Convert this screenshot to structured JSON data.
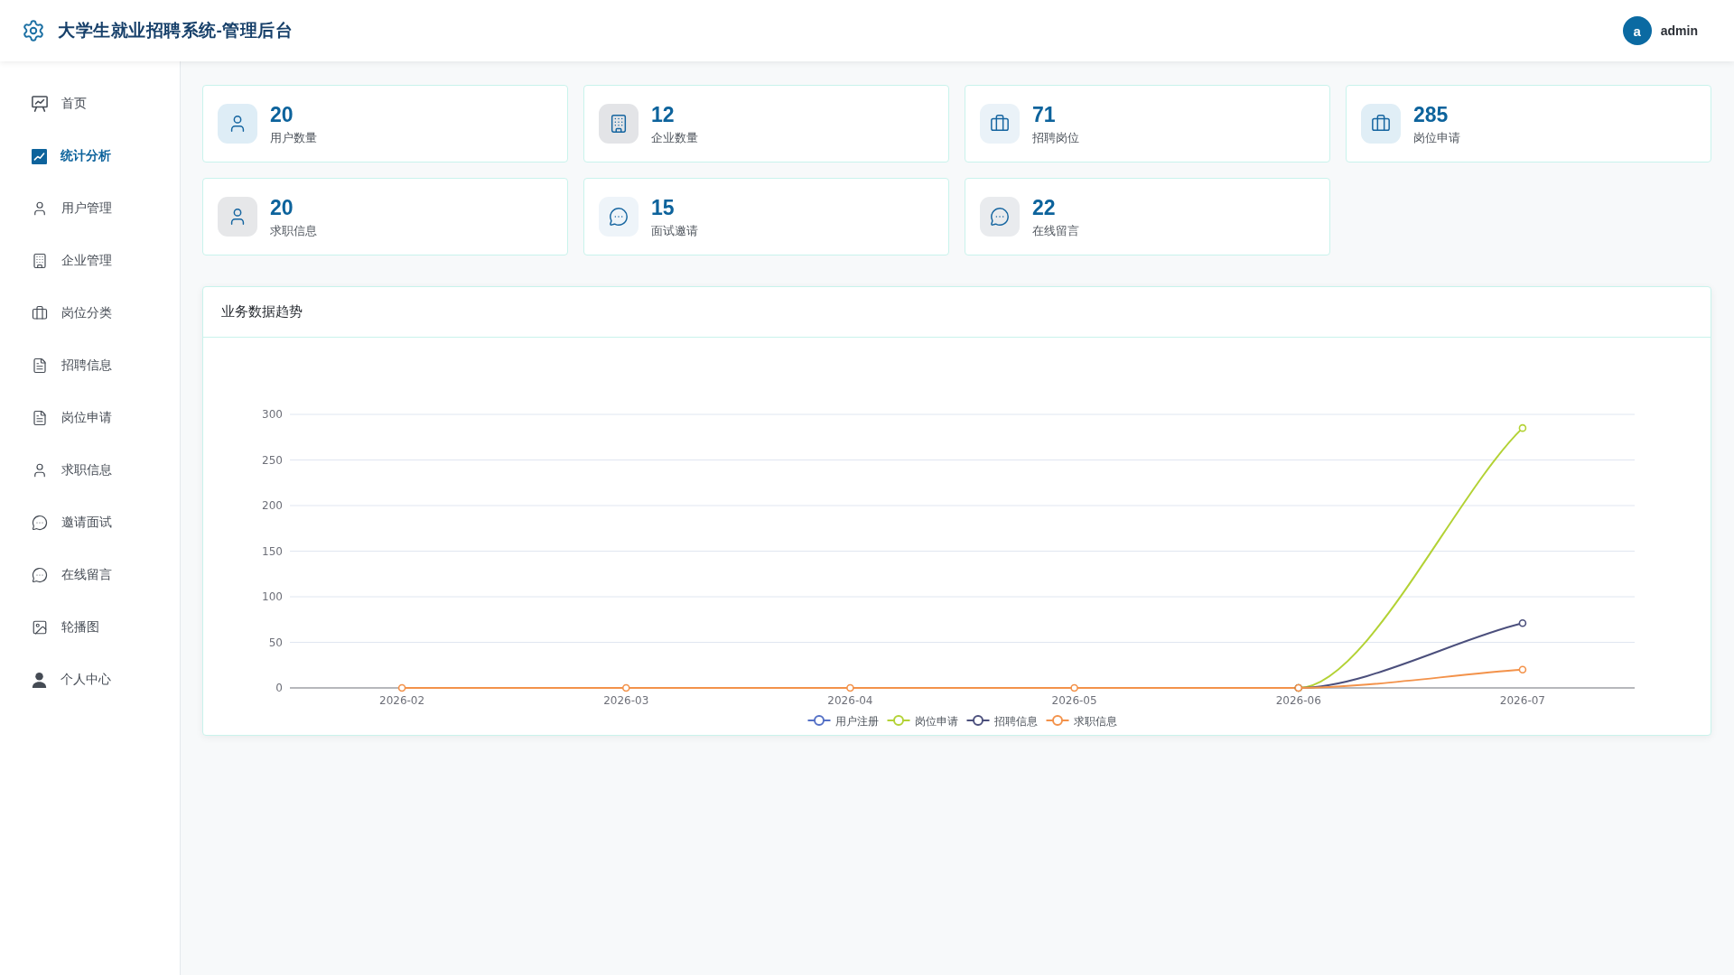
{
  "header": {
    "title": "大学生就业招聘系统-管理后台",
    "user": {
      "avatar_letter": "a",
      "name": "admin"
    }
  },
  "sidebar": {
    "items": [
      {
        "label": "首页",
        "kind": "home",
        "selected": false
      },
      {
        "label": "统计分析",
        "kind": "stats",
        "selected": true
      },
      {
        "label": "用户管理",
        "kind": "users",
        "selected": false
      },
      {
        "label": "企业管理",
        "kind": "companies",
        "selected": false
      },
      {
        "label": "岗位分类",
        "kind": "categories",
        "selected": false
      },
      {
        "label": "招聘信息",
        "kind": "postings",
        "selected": false
      },
      {
        "label": "岗位申请",
        "kind": "applications",
        "selected": false
      },
      {
        "label": "求职信息",
        "kind": "seekers",
        "selected": false
      },
      {
        "label": "邀请面试",
        "kind": "interviews",
        "selected": false
      },
      {
        "label": "在线留言",
        "kind": "messages",
        "selected": false
      },
      {
        "label": "轮播图",
        "kind": "banners",
        "selected": false
      },
      {
        "label": "个人中心",
        "kind": "profile",
        "selected": false
      }
    ]
  },
  "stats": [
    {
      "value": "20",
      "label": "用户数量",
      "kind": "users",
      "color": "#deedf6"
    },
    {
      "value": "12",
      "label": "企业数量",
      "kind": "companies",
      "color": "#e3e4e7"
    },
    {
      "value": "71",
      "label": "招聘岗位",
      "kind": "postings",
      "color": "#eaf2f8"
    },
    {
      "value": "285",
      "label": "岗位申请",
      "kind": "applications",
      "color": "#e0eef6"
    },
    {
      "value": "20",
      "label": "求职信息",
      "kind": "seekers",
      "color": "#e6e7e9"
    },
    {
      "value": "15",
      "label": "面试邀请",
      "kind": "interviews",
      "color": "#eef4f9"
    },
    {
      "value": "22",
      "label": "在线留言",
      "kind": "messages",
      "color": "#e9ebee"
    }
  ],
  "trend_panel": {
    "title": "业务数据趋势",
    "chart_data": {
      "type": "line",
      "categories": [
        "2026-02",
        "2026-03",
        "2026-04",
        "2026-05",
        "2026-06",
        "2026-07"
      ],
      "series": [
        {
          "name": "用户注册",
          "color": "#5470c6",
          "marker": "circle",
          "values": [
            null,
            null,
            null,
            null,
            null,
            null
          ]
        },
        {
          "name": "岗位申请",
          "color": "#b3d235",
          "marker": "circle",
          "values": [
            null,
            null,
            null,
            null,
            0,
            285
          ]
        },
        {
          "name": "招聘信息",
          "color": "#4b4f7c",
          "marker": "circle",
          "values": [
            null,
            null,
            null,
            null,
            0,
            71
          ]
        },
        {
          "name": "求职信息",
          "color": "#f3924a",
          "marker": "circle",
          "values": [
            0,
            0,
            0,
            0,
            0,
            20
          ]
        }
      ],
      "ylim": [
        0,
        300
      ],
      "yticks": [
        0,
        50,
        100,
        150,
        200,
        250,
        300
      ],
      "grid": true,
      "legend": "bottom"
    }
  }
}
